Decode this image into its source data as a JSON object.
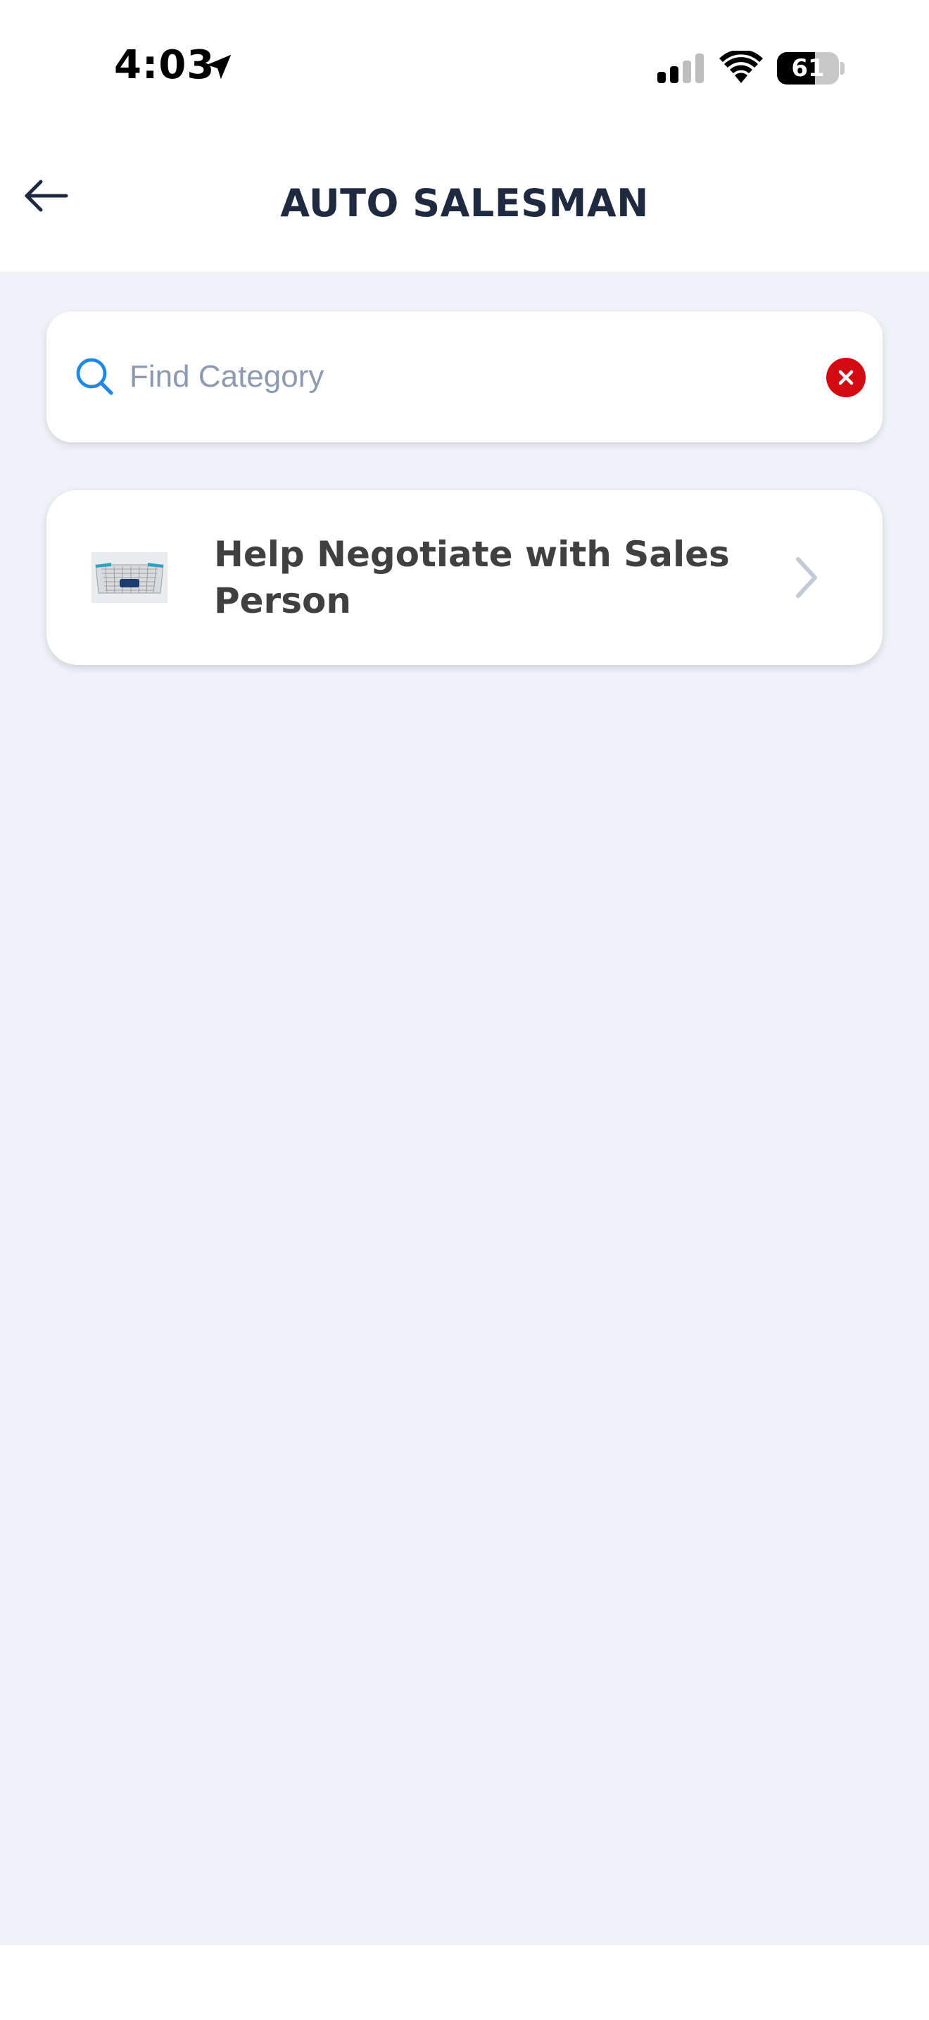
{
  "status_bar": {
    "time": "4:03",
    "battery_percent": "61",
    "battery_level": 0.61,
    "icons": [
      "location-arrow-icon",
      "signal-icon",
      "wifi-icon",
      "battery-icon"
    ]
  },
  "header": {
    "title": "AUTO SALESMAN",
    "back_icon": "arrow-left-icon"
  },
  "search": {
    "placeholder": "Find Category",
    "value": "",
    "icon": "search-icon",
    "clear_icon": "clear-x-icon"
  },
  "categories": [
    {
      "label": "Help Negotiate with Sales Person",
      "thumbnail": "car-grille-image",
      "chevron": "chevron-right-icon"
    }
  ],
  "colors": {
    "background": "#eff2f7",
    "title": "#1f2940",
    "accent_blue": "#1e88e5",
    "clear_red": "#d20a11",
    "placeholder": "#8d9ab0"
  }
}
